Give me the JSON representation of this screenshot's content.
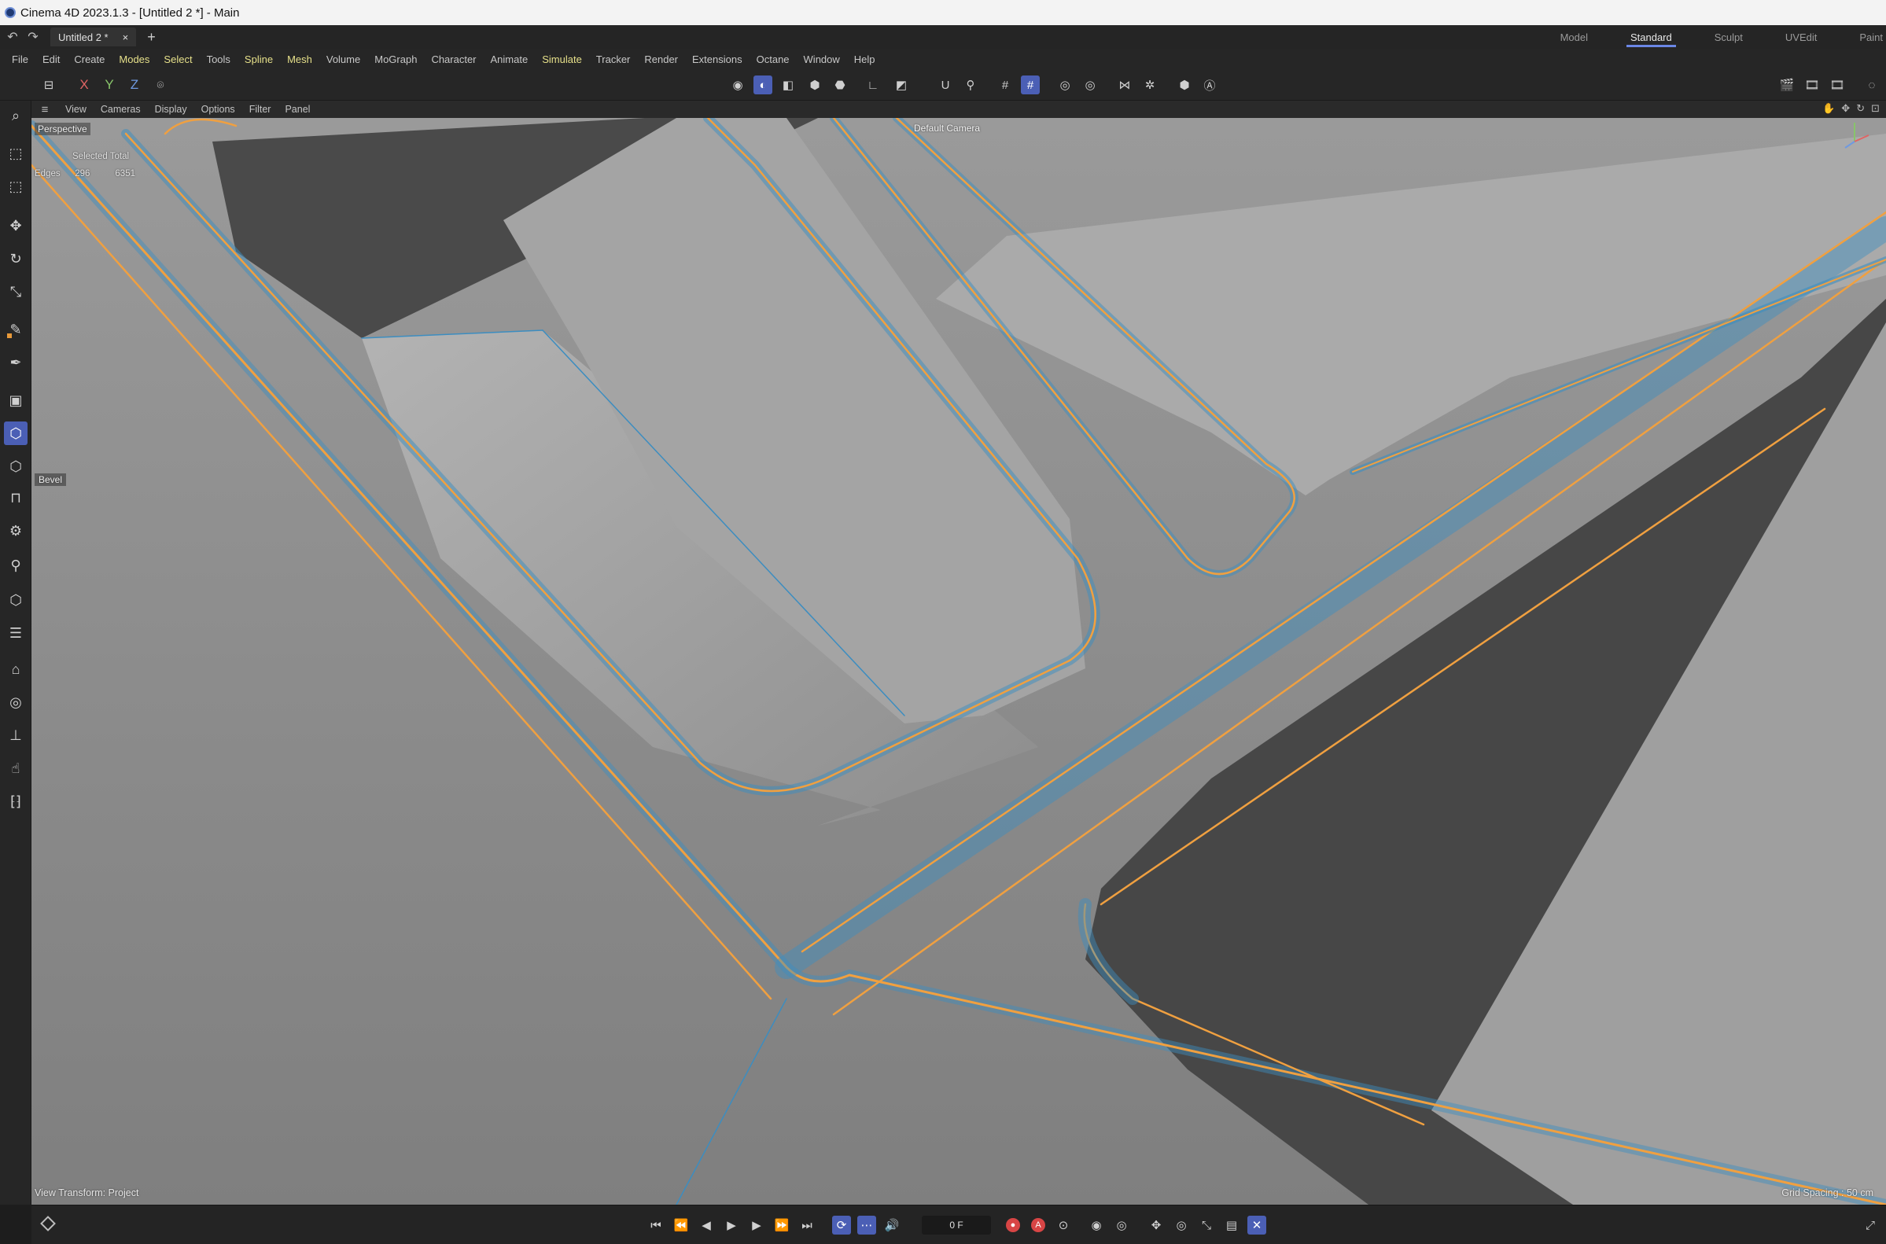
{
  "window": {
    "title": "Cinema 4D 2023.1.3 - [Untitled 2 *] - Main"
  },
  "tabs": {
    "doc_tab_label": "Untitled 2 *",
    "close_glyph": "×",
    "add_glyph": "+"
  },
  "layouts": [
    "Model",
    "Standard",
    "Sculpt",
    "UVEdit",
    "Paint"
  ],
  "active_layout": "Standard",
  "menu": [
    "File",
    "Edit",
    "Create",
    "Modes",
    "Select",
    "Tools",
    "Spline",
    "Mesh",
    "Volume",
    "MoGraph",
    "Character",
    "Animate",
    "Simulate",
    "Tracker",
    "Render",
    "Extensions",
    "Octane",
    "Window",
    "Help"
  ],
  "toolbar": {
    "axes": [
      "X",
      "Y",
      "Z"
    ],
    "icons": [
      "object-mode-icon",
      "point-mode-icon",
      "edge-mode-icon",
      "polygon-mode-icon",
      "uv-mode-icon",
      "axis-mode-icon",
      "solo-icon",
      "snap-icon",
      "workplane-icon",
      "grid-snap-icon",
      "quantize-icon",
      "symmetry-icon",
      "lock-icon",
      "viewport-solo-icon",
      "render-view-icon",
      "render-settings-icon",
      "render-queue-icon"
    ]
  },
  "viewport": {
    "menu": [
      "View",
      "Cameras",
      "Display",
      "Options",
      "Filter",
      "Panel"
    ],
    "projection": "Perspective",
    "camera": "Default Camera",
    "hud": {
      "header": "Selected Total",
      "row_label": "Edges",
      "selected": "296",
      "total": "6351"
    },
    "tool_label": "Bevel",
    "view_transform": "View Transform: Project",
    "grid_spacing": "Grid Spacing : 50 cm",
    "colors": {
      "selection": "#f0a040",
      "edge": "#3c8dc0",
      "surface_light": "#a9a9a9",
      "surface_dark": "#4a4a4a"
    }
  },
  "timeline": {
    "frame": "0 F"
  },
  "palette": [
    "live-selection-icon",
    "box-selection-icon",
    "move-icon",
    "rotate-icon",
    "scale-icon",
    "brush-icon",
    "pen-icon",
    "cube-icon",
    "polygon-pen-icon",
    "extrude-icon",
    "bridge-icon",
    "knife-icon",
    "magnet-icon",
    "subdivide-icon",
    "weld-icon",
    "slide-icon",
    "mirror-icon",
    "iron-icon",
    "spin-edge-icon",
    "dissolve-icon"
  ]
}
